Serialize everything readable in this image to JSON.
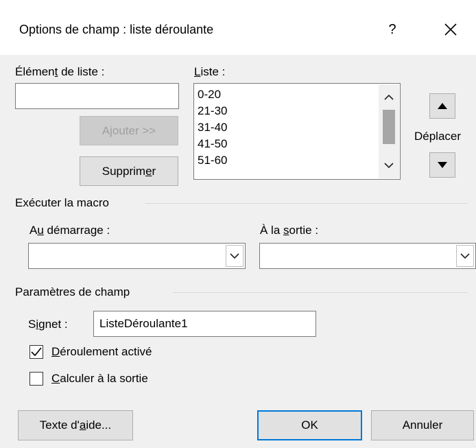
{
  "dialog": {
    "title": "Options de champ : liste déroulante",
    "help_label": "?",
    "close_label": "✕"
  },
  "item_section": {
    "item_label_pre": "Élémen",
    "item_label_key": "t",
    "item_label_post": " de liste :",
    "item_value": "",
    "add_label": "Ajouter >>",
    "remove_label_pre": "Supprim",
    "remove_label_key": "e",
    "remove_label_post": "r"
  },
  "list_section": {
    "label_key": "L",
    "label_post": "iste :",
    "items": [
      "0-20",
      "21-30",
      "31-40",
      "41-50",
      "51-60"
    ],
    "move_label": "Déplacer"
  },
  "macro_section": {
    "heading": "Exécuter la macro",
    "entry_label_pre": "A",
    "entry_label_key": "u",
    "entry_label_post": " démarrage :",
    "entry_value": "",
    "exit_label_pre": "À la ",
    "exit_label_key": "s",
    "exit_label_post": "ortie :",
    "exit_value": ""
  },
  "field_section": {
    "heading": "Paramètres de champ",
    "bookmark_label_pre": "S",
    "bookmark_label_key": "i",
    "bookmark_label_post": "gnet :",
    "bookmark_value": "ListeDéroulante1",
    "dropdown_enabled_key": "D",
    "dropdown_enabled_post": "éroulement activé",
    "dropdown_enabled_checked": true,
    "calc_on_exit_key": "C",
    "calc_on_exit_post": "alculer à la sortie",
    "calc_on_exit_checked": false
  },
  "footer": {
    "help_text_pre": "Texte d'",
    "help_text_key": "a",
    "help_text_post": "ide...",
    "ok_label": "OK",
    "cancel_label": "Annuler"
  },
  "colors": {
    "accent": "#0078d7",
    "window_bg": "#f0f0f0"
  }
}
